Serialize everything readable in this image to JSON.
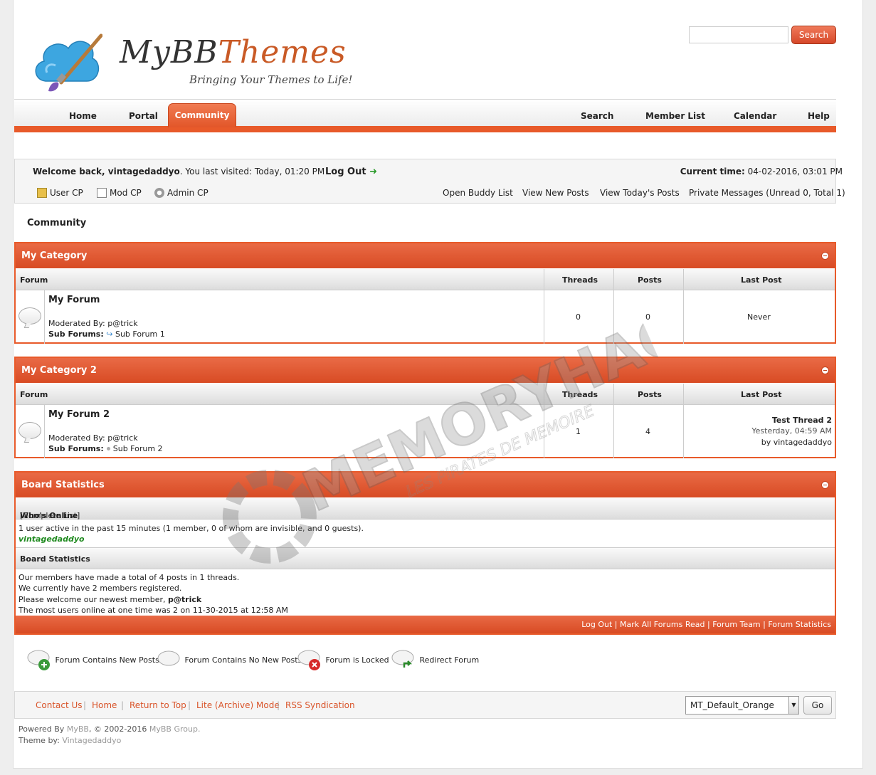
{
  "header": {
    "logo_main": "MyBB",
    "logo_accent": "Themes",
    "tagline": "Bringing Your Themes to Life!",
    "search_placeholder": "",
    "search_label": "Search"
  },
  "nav": {
    "home": "Home",
    "portal": "Portal",
    "community": "Community",
    "search": "Search",
    "member_list": "Member List",
    "calendar": "Calendar",
    "help": "Help"
  },
  "welcome": {
    "greeting": "Welcome back, vintagedaddyo",
    "last_visited": ". You last visited: Today, 01:20 PM",
    "logout": "Log Out",
    "current_time_label": "Current time:",
    "current_time": "04-02-2016, 03:01 PM",
    "user_cp": "User CP",
    "mod_cp": "Mod CP",
    "admin_cp": "Admin CP",
    "buddy_list": "Open Buddy List",
    "new_posts": "View New Posts",
    "todays_posts": "View Today's Posts",
    "pm": "Private Messages (Unread 0, Total 1)"
  },
  "breadcrumb": "Community",
  "columns": {
    "forum": "Forum",
    "threads": "Threads",
    "posts": "Posts",
    "last_post": "Last Post"
  },
  "categories": [
    {
      "title": "My Category",
      "forum": "My Forum",
      "moderated_label": "Moderated By:",
      "moderator": "p@trick",
      "sub_label": "Sub Forums:",
      "sub_forum": "Sub Forum 1",
      "threads": "0",
      "posts": "0",
      "last_post": "Never"
    },
    {
      "title": "My Category 2",
      "forum": "My Forum 2",
      "moderated_label": "Moderated By:",
      "moderator": "p@trick",
      "sub_label": "Sub Forums:",
      "sub_forum": "Sub Forum 2",
      "threads": "1",
      "posts": "4",
      "last_thread": "Test Thread 2",
      "last_time": "Yesterday, 04:59 AM",
      "last_by": "by vintagedaddyo"
    }
  ],
  "stats": {
    "title": "Board Statistics",
    "whos_online": "Who's Online",
    "complete_list": "[Complete List]",
    "online_text": "1 user active in the past 15 minutes (1 member, 0 of whom are invisible, and 0 guests).",
    "online_user": "vintagedaddyo",
    "board_stats": "Board Statistics",
    "line1": "Our members have made a total of 4 posts in 1 threads.",
    "line2": "We currently have 2 members registered.",
    "line3": "Please welcome our newest member,",
    "newest": "p@trick",
    "line4": "The most users online at one time was 2 on 11-30-2015 at 12:58 AM",
    "footer_links": "Log Out | Mark All Forums Read | Forum Team | Forum Statistics"
  },
  "legend": {
    "new": "Forum Contains New Posts",
    "no_new": "Forum Contains No New Posts",
    "locked": "Forum is Locked",
    "redirect": "Redirect Forum"
  },
  "footer": {
    "contact": "Contact Us",
    "home": "Home",
    "top": "Return to Top",
    "lite": "Lite (Archive) Mode",
    "rss": "RSS Syndication",
    "theme": "MT_Default_Orange",
    "go": "Go",
    "powered_by": "Powered By",
    "mybb": "MyBB",
    "copyright": ", © 2002-2016",
    "mybb_group": "MyBB Group.",
    "theme_by": "Theme by:",
    "theme_author": "Vintagedaddyo"
  },
  "watermark": {
    "text": "MEMORYHACKERS",
    "sub": "LES PIRATES DE MEMOIRE"
  },
  "colors": {
    "accent": "#e85a2a",
    "link": "#d9542a",
    "online_user": "#1f8a1f"
  }
}
